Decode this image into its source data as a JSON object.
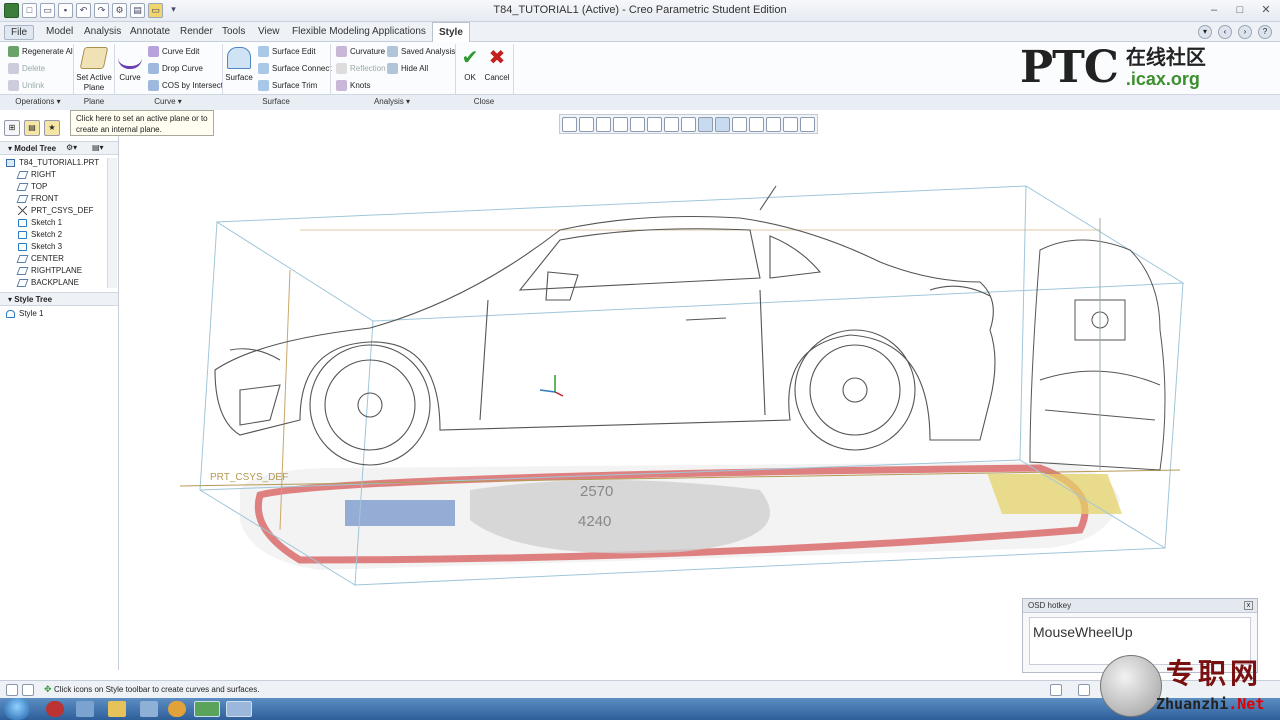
{
  "window": {
    "title": "T84_TUTORIAL1 (Active) - Creo Parametric Student Edition"
  },
  "menu": {
    "tabs": [
      "File",
      "Model",
      "Analysis",
      "Annotate",
      "Render",
      "Tools",
      "View",
      "Flexible Modeling",
      "Applications",
      "Style"
    ],
    "active": "Style"
  },
  "ribbon": {
    "operations": {
      "regenerate_all": "Regenerate All",
      "delete": "Delete",
      "unlink": "Unlink",
      "group": "Operations"
    },
    "plane": {
      "set_active_plane_1": "Set Active",
      "set_active_plane_2": "Plane",
      "group": "Plane"
    },
    "curve": {
      "curve": "Curve",
      "curve_edit": "Curve Edit",
      "drop_curve": "Drop Curve",
      "cos_by_intersect": "COS by Intersect",
      "group": "Curve"
    },
    "surface": {
      "surface": "Surface",
      "surface_edit": "Surface Edit",
      "surface_connect": "Surface Connect",
      "surface_trim": "Surface Trim",
      "group": "Surface"
    },
    "analysis": {
      "curvature": "Curvature",
      "reflection": "Reflection",
      "knots": "Knots",
      "saved_analysis": "Saved Analysis",
      "hide_all": "Hide All",
      "group": "Analysis"
    },
    "close": {
      "ok": "OK",
      "cancel": "Cancel",
      "group": "Close"
    }
  },
  "logo": {
    "ptc": "PTC",
    "cn": "在线社区",
    "url": ".icax.org"
  },
  "tooltip": "Click here to set an active plane or to create an internal plane.",
  "model_tree": {
    "header": "Model Tree",
    "root": "T84_TUTORIAL1.PRT",
    "items": [
      {
        "label": "RIGHT",
        "icon": "plane"
      },
      {
        "label": "TOP",
        "icon": "plane"
      },
      {
        "label": "FRONT",
        "icon": "plane"
      },
      {
        "label": "PRT_CSYS_DEF",
        "icon": "csys"
      },
      {
        "label": "Sketch 1",
        "icon": "sketch"
      },
      {
        "label": "Sketch 2",
        "icon": "sketch"
      },
      {
        "label": "Sketch 3",
        "icon": "sketch"
      },
      {
        "label": "CENTER",
        "icon": "plane"
      },
      {
        "label": "RIGHTPLANE",
        "icon": "plane"
      },
      {
        "label": "BACKPLANE",
        "icon": "plane"
      }
    ]
  },
  "style_tree": {
    "header": "Style Tree",
    "items": [
      "Style 1"
    ]
  },
  "viewport": {
    "csys_label": "PRT_CSYS_DEF",
    "dim1": "2570",
    "dim2": "4240"
  },
  "osd": {
    "header": "OSD hotkey",
    "text": "MouseWheelUp"
  },
  "status": {
    "message": "Click icons on Style toolbar to create curves and surfaces."
  },
  "watermark": {
    "cn": "专职网",
    "url_z": "Zhuanzhi",
    "url_rest": ".Net"
  },
  "colors": {
    "accent": "#2b7bc4",
    "ok_green": "#2e9a2e",
    "cancel_red": "#c42020",
    "taskbar": "#2e5f99"
  }
}
